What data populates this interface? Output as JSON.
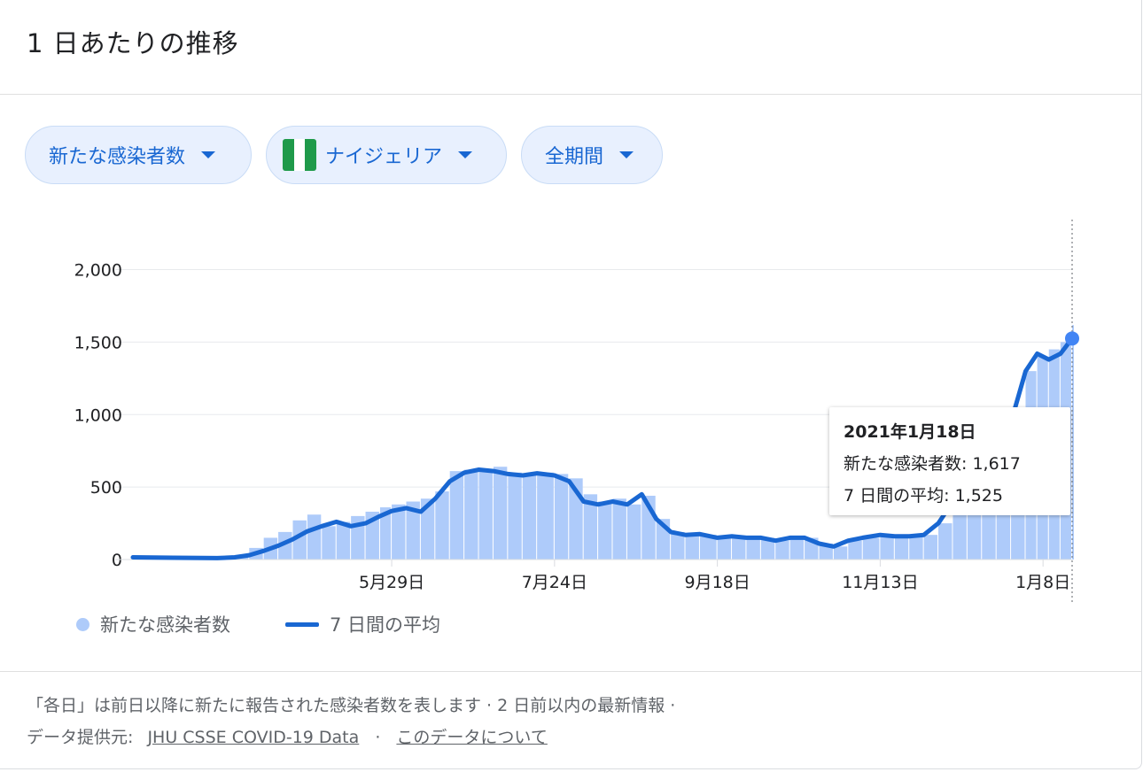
{
  "header": {
    "title": "1 日あたりの推移"
  },
  "filters": {
    "metric": "新たな感染者数",
    "country": "ナイジェリア",
    "period": "全期間"
  },
  "colors": {
    "bar": "#aecbfa",
    "line": "#1967d2",
    "flag_green": "#1f9a4a",
    "accent": "#1967d2"
  },
  "legend": {
    "bars": "新たな感染者数",
    "line": "7 日間の平均"
  },
  "tooltip": {
    "date": "2021年1月18日",
    "cases_text": "新たな感染者数: 1,617",
    "avg_text": "7 日間の平均: 1,525"
  },
  "footer": {
    "line1": "「各日」は前日以降に新たに報告された感染者数を表します · 2 日前以内の最新情報 ·",
    "source_label": "データ提供元:",
    "source_link": "JHU CSSE COVID-19 Data",
    "sep": "·",
    "about_link": "このデータについて"
  },
  "chart_data": {
    "type": "bar",
    "y_ticks": [
      "2,000",
      "1,500",
      "1,000",
      "500",
      "0"
    ],
    "x_ticks": [
      "5月29日",
      "7月24日",
      "9月18日",
      "11月13日",
      "1月8日"
    ],
    "ylim": [
      0,
      2150
    ],
    "x_start": "2020-03-01",
    "x_end": "2021-01-18",
    "series": [
      {
        "name": "新たな感染者数",
        "kind": "bar",
        "points": [
          [
            "2020-03-01",
            5
          ],
          [
            "2020-03-15",
            10
          ],
          [
            "2020-03-30",
            20
          ],
          [
            "2020-04-05",
            30
          ],
          [
            "2020-04-10",
            80
          ],
          [
            "2020-04-15",
            150
          ],
          [
            "2020-04-20",
            190
          ],
          [
            "2020-04-25",
            270
          ],
          [
            "2020-04-30",
            310
          ],
          [
            "2020-05-05",
            230
          ],
          [
            "2020-05-10",
            260
          ],
          [
            "2020-05-15",
            300
          ],
          [
            "2020-05-20",
            330
          ],
          [
            "2020-05-25",
            360
          ],
          [
            "2020-05-29",
            380
          ],
          [
            "2020-06-03",
            400
          ],
          [
            "2020-06-08",
            420
          ],
          [
            "2020-06-13",
            470
          ],
          [
            "2020-06-18",
            610
          ],
          [
            "2020-06-23",
            620
          ],
          [
            "2020-06-28",
            620
          ],
          [
            "2020-07-03",
            640
          ],
          [
            "2020-07-08",
            600
          ],
          [
            "2020-07-13",
            590
          ],
          [
            "2020-07-18",
            600
          ],
          [
            "2020-07-24",
            590
          ],
          [
            "2020-07-29",
            560
          ],
          [
            "2020-08-03",
            450
          ],
          [
            "2020-08-08",
            400
          ],
          [
            "2020-08-13",
            420
          ],
          [
            "2020-08-18",
            380
          ],
          [
            "2020-08-23",
            440
          ],
          [
            "2020-08-28",
            280
          ],
          [
            "2020-09-02",
            190
          ],
          [
            "2020-09-07",
            170
          ],
          [
            "2020-09-12",
            170
          ],
          [
            "2020-09-18",
            150
          ],
          [
            "2020-09-23",
            160
          ],
          [
            "2020-09-28",
            150
          ],
          [
            "2020-10-03",
            150
          ],
          [
            "2020-10-08",
            130
          ],
          [
            "2020-10-13",
            150
          ],
          [
            "2020-10-18",
            150
          ],
          [
            "2020-10-23",
            110
          ],
          [
            "2020-10-28",
            90
          ],
          [
            "2020-11-02",
            130
          ],
          [
            "2020-11-07",
            150
          ],
          [
            "2020-11-13",
            170
          ],
          [
            "2020-11-18",
            170
          ],
          [
            "2020-11-23",
            160
          ],
          [
            "2020-11-28",
            170
          ],
          [
            "2020-12-03",
            250
          ],
          [
            "2020-12-08",
            400
          ],
          [
            "2020-12-13",
            600
          ],
          [
            "2020-12-18",
            800
          ],
          [
            "2020-12-23",
            900
          ],
          [
            "2020-12-28",
            950
          ],
          [
            "2021-01-02",
            1300
          ],
          [
            "2021-01-06",
            1400
          ],
          [
            "2021-01-10",
            1450
          ],
          [
            "2021-01-14",
            1500
          ],
          [
            "2021-01-18",
            1617
          ]
        ]
      },
      {
        "name": "7 日間の平均",
        "kind": "line",
        "points": [
          [
            "2020-03-01",
            15
          ],
          [
            "2020-03-15",
            12
          ],
          [
            "2020-03-30",
            10
          ],
          [
            "2020-04-05",
            15
          ],
          [
            "2020-04-10",
            30
          ],
          [
            "2020-04-15",
            60
          ],
          [
            "2020-04-20",
            95
          ],
          [
            "2020-04-25",
            140
          ],
          [
            "2020-04-30",
            195
          ],
          [
            "2020-05-05",
            230
          ],
          [
            "2020-05-10",
            260
          ],
          [
            "2020-05-15",
            230
          ],
          [
            "2020-05-20",
            250
          ],
          [
            "2020-05-25",
            300
          ],
          [
            "2020-05-29",
            335
          ],
          [
            "2020-06-03",
            355
          ],
          [
            "2020-06-08",
            330
          ],
          [
            "2020-06-13",
            420
          ],
          [
            "2020-06-18",
            540
          ],
          [
            "2020-06-23",
            600
          ],
          [
            "2020-06-28",
            620
          ],
          [
            "2020-07-03",
            610
          ],
          [
            "2020-07-08",
            590
          ],
          [
            "2020-07-13",
            580
          ],
          [
            "2020-07-18",
            595
          ],
          [
            "2020-07-24",
            580
          ],
          [
            "2020-07-29",
            540
          ],
          [
            "2020-08-03",
            400
          ],
          [
            "2020-08-08",
            380
          ],
          [
            "2020-08-13",
            400
          ],
          [
            "2020-08-18",
            380
          ],
          [
            "2020-08-23",
            450
          ],
          [
            "2020-08-28",
            280
          ],
          [
            "2020-09-02",
            190
          ],
          [
            "2020-09-07",
            170
          ],
          [
            "2020-09-12",
            175
          ],
          [
            "2020-09-18",
            150
          ],
          [
            "2020-09-23",
            160
          ],
          [
            "2020-09-28",
            150
          ],
          [
            "2020-10-03",
            150
          ],
          [
            "2020-10-08",
            130
          ],
          [
            "2020-10-13",
            150
          ],
          [
            "2020-10-18",
            150
          ],
          [
            "2020-10-23",
            110
          ],
          [
            "2020-10-28",
            90
          ],
          [
            "2020-11-02",
            130
          ],
          [
            "2020-11-07",
            150
          ],
          [
            "2020-11-13",
            170
          ],
          [
            "2020-11-18",
            160
          ],
          [
            "2020-11-23",
            160
          ],
          [
            "2020-11-28",
            170
          ],
          [
            "2020-12-03",
            250
          ],
          [
            "2020-12-08",
            400
          ],
          [
            "2020-12-13",
            600
          ],
          [
            "2020-12-18",
            780
          ],
          [
            "2020-12-23",
            850
          ],
          [
            "2020-12-28",
            950
          ],
          [
            "2021-01-02",
            1300
          ],
          [
            "2021-01-06",
            1420
          ],
          [
            "2021-01-10",
            1380
          ],
          [
            "2021-01-14",
            1420
          ],
          [
            "2021-01-18",
            1525
          ]
        ]
      }
    ],
    "highlight": {
      "date": "2021-01-18",
      "value": 1525
    },
    "grid": true
  }
}
